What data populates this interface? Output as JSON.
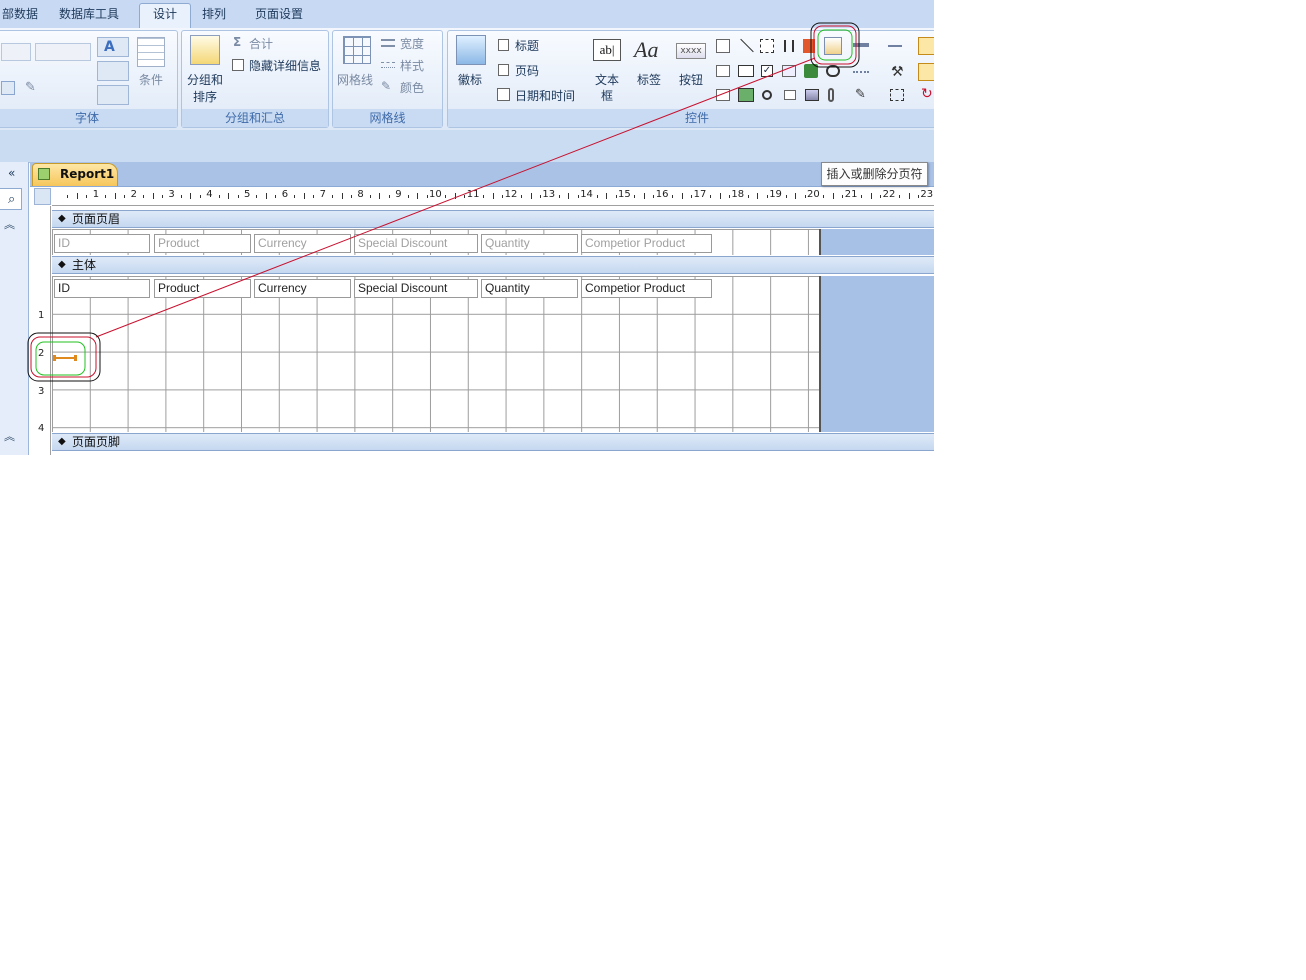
{
  "tabs": [
    {
      "label": "部数据"
    },
    {
      "label": "数据库工具"
    },
    {
      "label": "设计"
    },
    {
      "label": "排列"
    },
    {
      "label": "页面设置"
    }
  ],
  "ribbon": {
    "font_group": {
      "label": "字体",
      "conditional_label": "条件"
    },
    "grouping_group": {
      "label": "分组和汇总",
      "sort_label_1": "分组和",
      "sort_label_2": "排序",
      "total_label": "合计",
      "hide_details_label": "隐藏详细信息"
    },
    "gridlines_group": {
      "label": "网格线",
      "gridlines_label": "网格线",
      "width_label": "宽度",
      "style_label": "样式",
      "color_label": "颜色"
    },
    "controls_group": {
      "label": "控件",
      "logo_label": "徽标",
      "title_label": "标题",
      "page_number_label": "页码",
      "datetime_label": "日期和时间",
      "textbox_label_1": "文本",
      "textbox_label_2": "框",
      "label_label": "标签",
      "button_label": "按钮",
      "button_icon_text": "xxxx",
      "textbox_icon_text": "ab|",
      "label_icon_text": "Aa"
    }
  },
  "document": {
    "tab_label": "Report1"
  },
  "tooltip": "插入或删除分页符",
  "ruler_numbers": [
    "1",
    "2",
    "3",
    "4",
    "5",
    "6",
    "7",
    "8",
    "9",
    "10",
    "11",
    "12",
    "13",
    "14",
    "15",
    "16",
    "17",
    "18",
    "19",
    "20",
    "21",
    "22",
    "23"
  ],
  "ruler_v_numbers": [
    "1",
    "2",
    "3",
    "4"
  ],
  "sections": {
    "page_header": "页面页眉",
    "detail": "主体",
    "page_footer": "页面页脚"
  },
  "header_fields": [
    "ID",
    "Product",
    "Currency",
    "Special Discount",
    "Quantity",
    "Competior Product"
  ],
  "detail_fields": [
    "ID",
    "Product",
    "Currency",
    "Special Discount",
    "Quantity",
    "Competior Product"
  ],
  "colors": {
    "accent": "#c8102e",
    "highlight_green": "#22c022",
    "ribbon_bg": "#dde8f7"
  }
}
